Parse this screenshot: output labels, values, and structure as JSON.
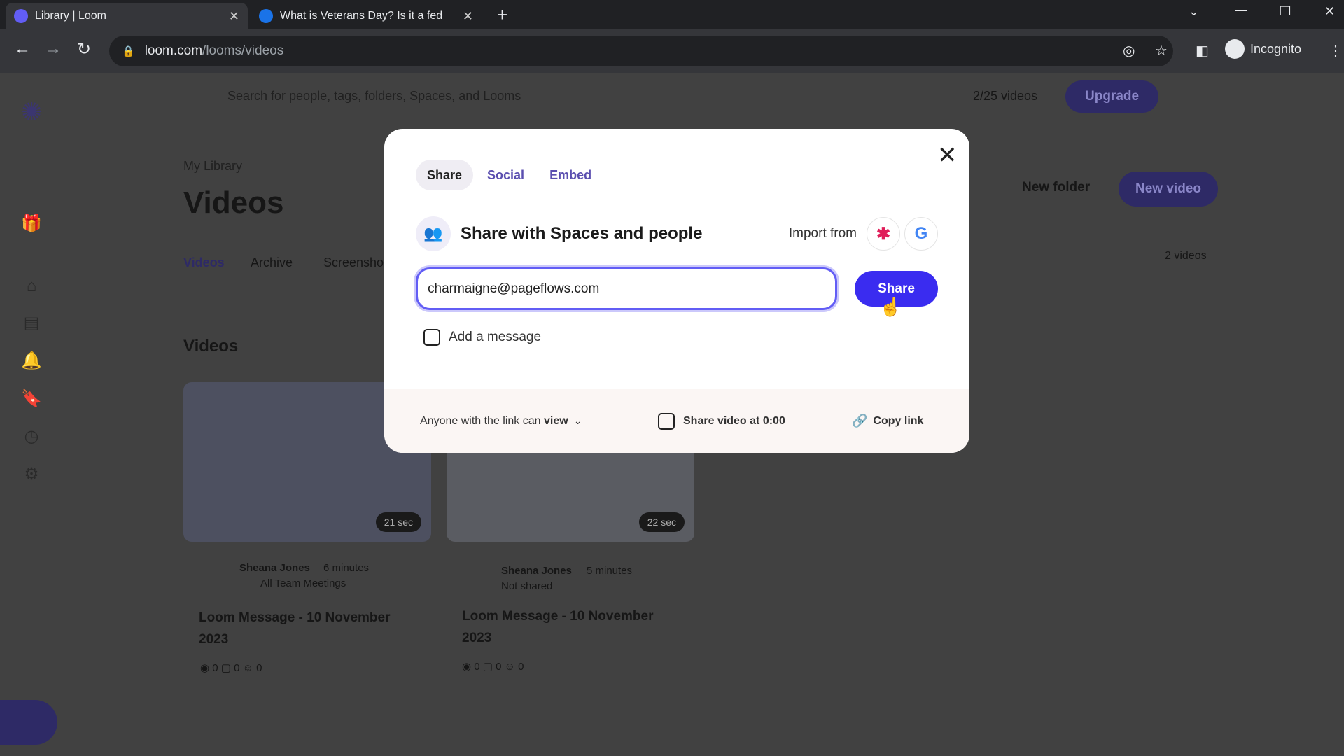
{
  "browser": {
    "tabs": [
      {
        "title": "Library | Loom",
        "active": true
      },
      {
        "title": "What is Veterans Day? Is it a fed",
        "active": false
      }
    ],
    "url_host": "loom.com",
    "url_path": "/looms/videos",
    "profile": "Incognito"
  },
  "page": {
    "search_placeholder": "Search for people, tags, folders, Spaces, and Looms",
    "video_count": "2/25 videos",
    "upgrade": "Upgrade",
    "breadcrumb": "My Library",
    "title": "Videos",
    "tabs": [
      "Videos",
      "Archive",
      "Screenshots"
    ],
    "new_folder": "New folder",
    "new_video": "New video",
    "section": "Videos",
    "count": "2 videos",
    "videos": [
      {
        "author": "Sheana Jones",
        "time": "6 minutes",
        "space": "All Team Meetings",
        "title": "Loom Message - 10 November 2023",
        "duration": "21 sec",
        "views": "0",
        "comments": "0",
        "reactions": "0"
      },
      {
        "author": "Sheana Jones",
        "time": "5 minutes",
        "space": "Not shared",
        "title": "Loom Message - 10 November 2023",
        "duration": "22 sec",
        "views": "0",
        "comments": "0",
        "reactions": "0"
      }
    ]
  },
  "modal": {
    "tabs": [
      "Share",
      "Social",
      "Embed"
    ],
    "heading": "Share with Spaces and people",
    "import_from": "Import from",
    "email_value": "charmaigne@pageflows.com",
    "share_button": "Share",
    "add_message": "Add a message",
    "permission_prefix": "Anyone with the link can ",
    "permission_value": "view",
    "share_at": "Share video at 0:00",
    "copy_link": "Copy link"
  },
  "colors": {
    "accent": "#3a2cf0",
    "focus": "#625df5"
  }
}
